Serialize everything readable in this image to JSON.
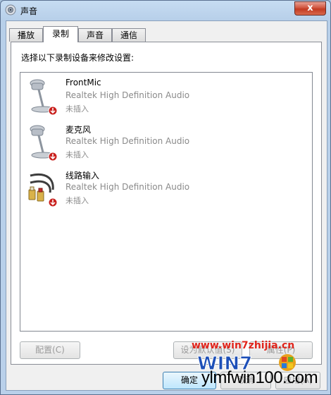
{
  "window": {
    "title": "声音",
    "close_label": "x"
  },
  "tabs": [
    {
      "label": "播放",
      "active": false
    },
    {
      "label": "录制",
      "active": true
    },
    {
      "label": "声音",
      "active": false
    },
    {
      "label": "通信",
      "active": false
    }
  ],
  "instruction": "选择以下录制设备来修改设置:",
  "devices": [
    {
      "name": "FrontMic",
      "driver": "Realtek High Definition Audio",
      "status": "未插入",
      "icon": "microphone-icon"
    },
    {
      "name": "麦克风",
      "driver": "Realtek High Definition Audio",
      "status": "未插入",
      "icon": "microphone-icon"
    },
    {
      "name": "线路输入",
      "driver": "Realtek High Definition Audio",
      "status": "未插入",
      "icon": "line-in-cable-icon"
    }
  ],
  "buttons": {
    "configure": "配置(C)",
    "set_default": "设为默认值(S)",
    "properties": "属性(P)",
    "ok": "确定",
    "cancel": "取消",
    "apply": "应用(A)"
  },
  "watermark": {
    "site1": "www.win7zhijia.cn",
    "brand": "WIN7",
    "site2": "ylmfwin100.com"
  },
  "colors": {
    "status_disabled": "#8a8a8a",
    "accent": "#3c7fb1",
    "watermark_red": "#e0241b"
  }
}
